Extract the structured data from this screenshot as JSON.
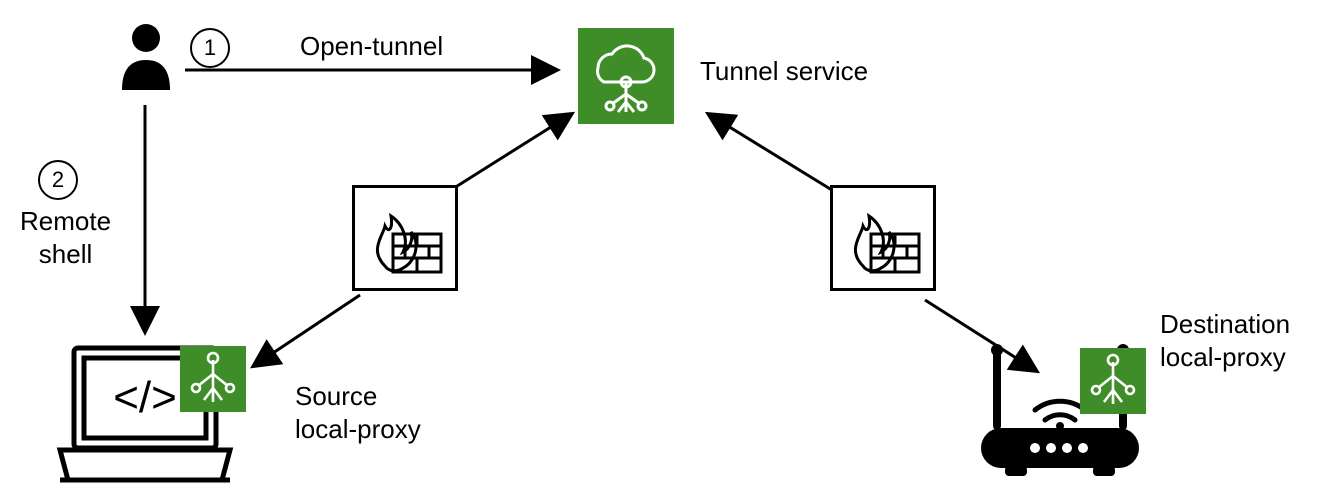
{
  "steps": {
    "1": "1",
    "2": "2"
  },
  "labels": {
    "open_tunnel": "Open-tunnel",
    "remote_shell": "Remote\nshell",
    "tunnel_service": "Tunnel service",
    "source_proxy": "Source\nlocal-proxy",
    "destination_proxy": "Destination\nlocal-proxy"
  }
}
